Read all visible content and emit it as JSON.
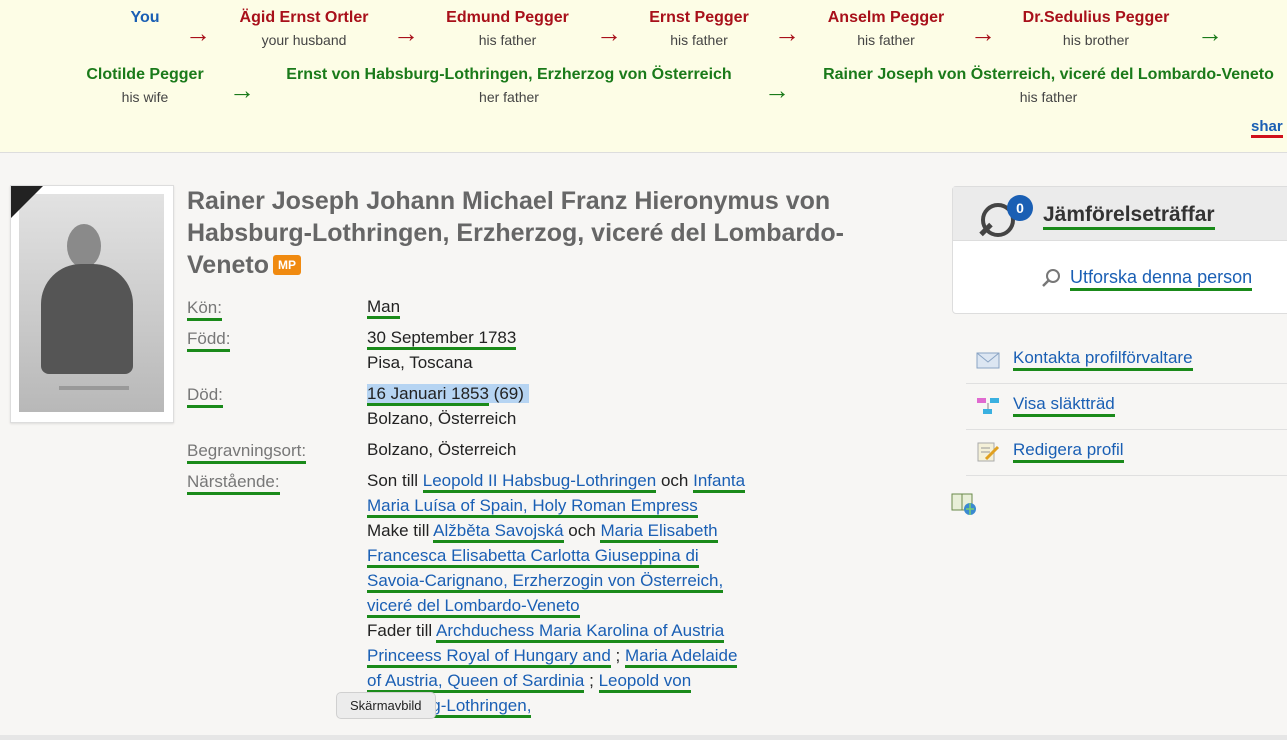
{
  "relationship": {
    "row1": [
      {
        "name": "You",
        "sub": ""
      },
      {
        "name": "Ägid Ernst Ortler",
        "sub": "your husband"
      },
      {
        "name": "Edmund Pegger",
        "sub": "his father"
      },
      {
        "name": "Ernst Pegger",
        "sub": "his father"
      },
      {
        "name": "Anselm Pegger",
        "sub": "his father"
      },
      {
        "name": "Dr.Sedulius Pegger",
        "sub": "his brother"
      }
    ],
    "row2": [
      {
        "name": "Clotilde Pegger",
        "sub": "his wife"
      },
      {
        "name": "Ernst von Habsburg-Lothringen, Erzherzog von Österreich",
        "sub": "her father"
      },
      {
        "name": "Rainer Joseph von Österreich, viceré del Lombardo-Veneto",
        "sub": "his father"
      }
    ],
    "arrow": "→",
    "share": "shar"
  },
  "profile": {
    "title": "Rainer Joseph Johann Michael Franz Hieronymus von Habsburg-Lothringen, Erzherzog, viceré del Lombardo-Veneto",
    "badge": "MP",
    "gender_label": "Kön:",
    "gender": "Man",
    "born_label": "Född:",
    "born_date": "30 September 1783",
    "born_place": "Pisa, Toscana",
    "died_label": "Död:",
    "died_date": "16 Januari 1853",
    "died_age": "(69)",
    "died_place": "Bolzano, Österreich",
    "burial_label": "Begravningsort:",
    "burial_place": "Bolzano, Österreich",
    "relatives_label": "Närstående:",
    "relatives": {
      "son_of": "Son till",
      "father": "Leopold II Habsbug-Lothringen",
      "and1": "och",
      "mother": "Infanta Maria Luísa of Spain, Holy Roman Empress",
      "husband_of": "Make till",
      "wife1": "Alžběta Savojská",
      "and2": "och",
      "wife2": "Maria Elisabeth Francesca Elisabetta Carlotta Giuseppina di Savoia-Carignano, Erzherzogin von Österreich, viceré del Lombardo-Veneto",
      "father_of": "Fader till",
      "child1": "Archduchess Maria Karolina of Austria Princeess Royal of Hungary and",
      "sep": ";",
      "child2": "Maria Adelaide of Austria, Queen of Sardinia",
      "child3": "Leopold von Habsburg-Lothringen,"
    }
  },
  "sidebar": {
    "compare_count": "0",
    "compare_title": "Jämförelseträffar",
    "explore": "Utforska denna person",
    "actions": [
      "Kontakta profilförvaltare",
      "Visa släktträd",
      "Redigera profil"
    ]
  },
  "tooltip": "Skärmavbild"
}
